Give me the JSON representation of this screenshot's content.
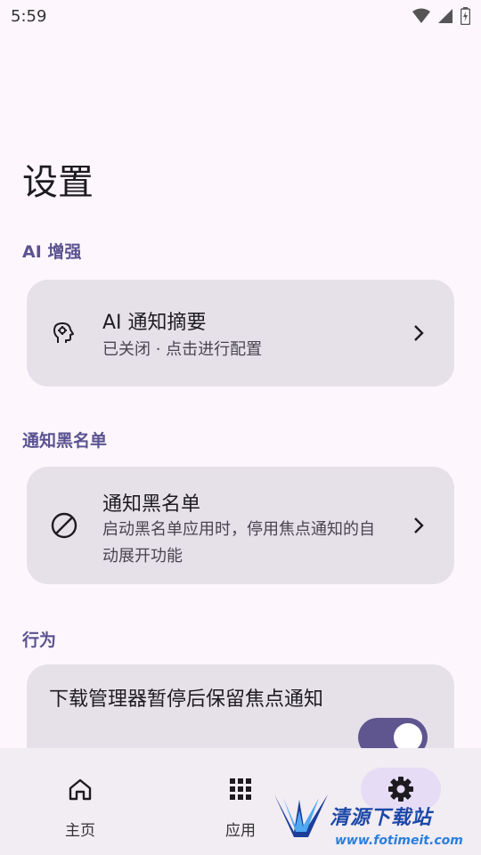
{
  "status_bar": {
    "time": "5:59"
  },
  "page_title": "设置",
  "sections": {
    "ai": {
      "header": "AI 增强",
      "card": {
        "title": "AI 通知摘要",
        "subtitle": "已关闭 · 点击进行配置",
        "icon": "brain-head-icon"
      }
    },
    "blacklist": {
      "header": "通知黑名单",
      "card": {
        "title": "通知黑名单",
        "subtitle": "启动黑名单应用时，停用焦点通知的自动展开功能",
        "icon": "block-icon"
      }
    },
    "behavior": {
      "header": "行为",
      "card": {
        "title": "下载管理器暂停后保留焦点通知",
        "toggle_on": true
      }
    }
  },
  "bottom_nav": {
    "items": [
      {
        "label": "主页",
        "icon": "home-icon"
      },
      {
        "label": "应用",
        "icon": "apps-grid-icon"
      },
      {
        "label": "",
        "icon": "settings-gear-icon",
        "active": true
      }
    ]
  },
  "watermark": {
    "text": "清源下载站",
    "url": "www.fotimeit.com"
  },
  "colors": {
    "background": "#fdf7fd",
    "card": "#e6e1e9",
    "accent": "#5f558f",
    "section_header": "#5b5390",
    "nav_bar": "#f2ecf3"
  }
}
